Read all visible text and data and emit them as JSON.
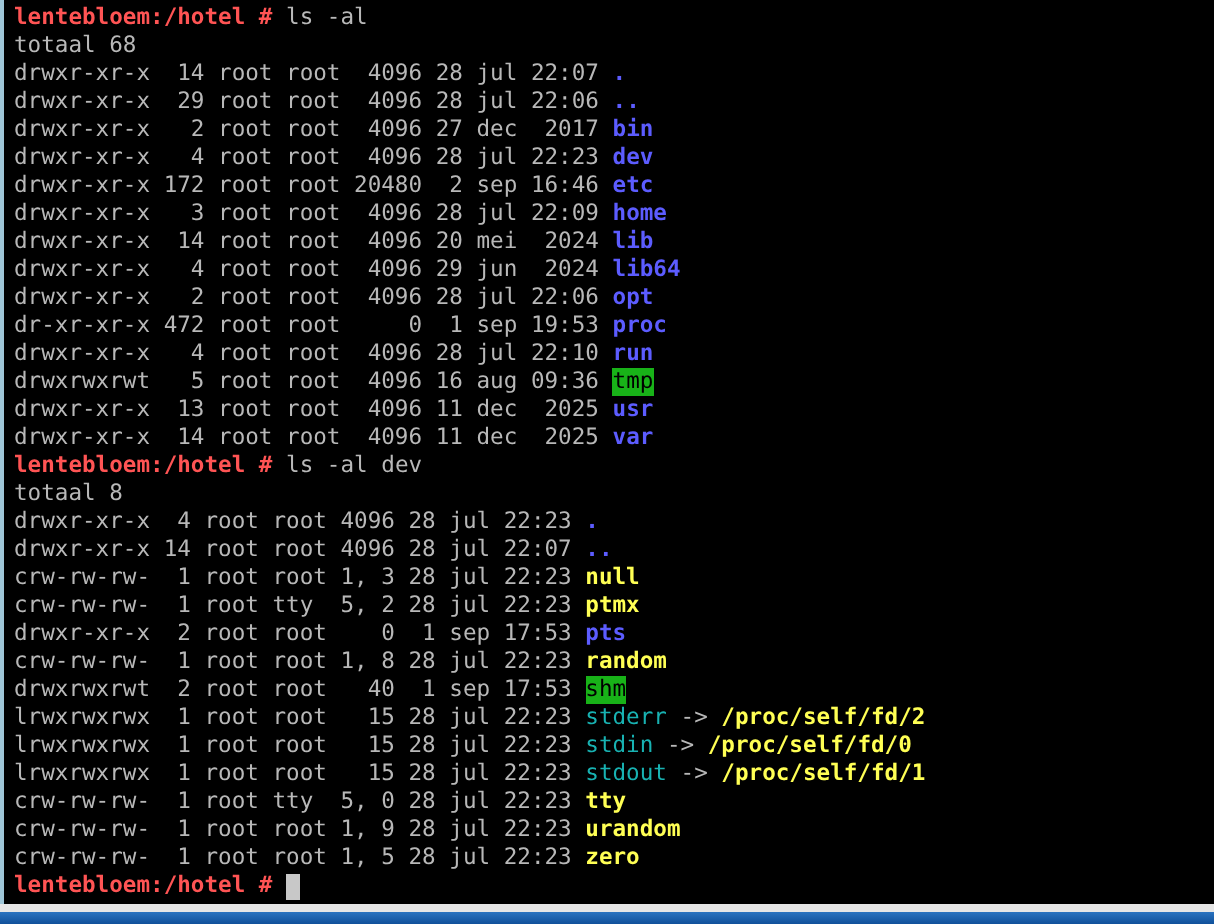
{
  "terminal": {
    "lines": [
      {
        "kind": "prompt",
        "prompt": "lentebloem:/hotel #",
        "command": "ls -al",
        "cursor": false
      },
      {
        "kind": "text",
        "text": "totaal 68"
      },
      {
        "kind": "dir",
        "meta": "drwxr-xr-x  14 root root  4096 28 jul 22:07",
        "name": "."
      },
      {
        "kind": "dir",
        "meta": "drwxr-xr-x  29 root root  4096 28 jul 22:06",
        "name": ".."
      },
      {
        "kind": "dir",
        "meta": "drwxr-xr-x   2 root root  4096 27 dec  2017",
        "name": "bin"
      },
      {
        "kind": "dir",
        "meta": "drwxr-xr-x   4 root root  4096 28 jul 22:23",
        "name": "dev"
      },
      {
        "kind": "dir",
        "meta": "drwxr-xr-x 172 root root 20480  2 sep 16:46",
        "name": "etc"
      },
      {
        "kind": "dir",
        "meta": "drwxr-xr-x   3 root root  4096 28 jul 22:09",
        "name": "home"
      },
      {
        "kind": "dir",
        "meta": "drwxr-xr-x  14 root root  4096 20 mei  2024",
        "name": "lib"
      },
      {
        "kind": "dir",
        "meta": "drwxr-xr-x   4 root root  4096 29 jun  2024",
        "name": "lib64"
      },
      {
        "kind": "dir",
        "meta": "drwxr-xr-x   2 root root  4096 28 jul 22:06",
        "name": "opt"
      },
      {
        "kind": "dir",
        "meta": "dr-xr-xr-x 472 root root     0  1 sep 19:53",
        "name": "proc"
      },
      {
        "kind": "dir",
        "meta": "drwxr-xr-x   4 root root  4096 28 jul 22:10",
        "name": "run"
      },
      {
        "kind": "sticky",
        "meta": "drwxrwxrwt   5 root root  4096 16 aug 09:36",
        "name": "tmp"
      },
      {
        "kind": "dir",
        "meta": "drwxr-xr-x  13 root root  4096 11 dec  2025",
        "name": "usr"
      },
      {
        "kind": "dir",
        "meta": "drwxr-xr-x  14 root root  4096 11 dec  2025",
        "name": "var"
      },
      {
        "kind": "prompt",
        "prompt": "lentebloem:/hotel #",
        "command": "ls -al dev",
        "cursor": false
      },
      {
        "kind": "text",
        "text": "totaal 8"
      },
      {
        "kind": "dir",
        "meta": "drwxr-xr-x  4 root root 4096 28 jul 22:23",
        "name": "."
      },
      {
        "kind": "dir",
        "meta": "drwxr-xr-x 14 root root 4096 28 jul 22:07",
        "name": ".."
      },
      {
        "kind": "chardev",
        "meta": "crw-rw-rw-  1 root root 1, 3 28 jul 22:23",
        "name": "null"
      },
      {
        "kind": "chardev",
        "meta": "crw-rw-rw-  1 root tty  5, 2 28 jul 22:23",
        "name": "ptmx"
      },
      {
        "kind": "dir",
        "meta": "drwxr-xr-x  2 root root    0  1 sep 17:53",
        "name": "pts"
      },
      {
        "kind": "chardev",
        "meta": "crw-rw-rw-  1 root root 1, 8 28 jul 22:23",
        "name": "random"
      },
      {
        "kind": "sticky",
        "meta": "drwxrwxrwt  2 root root   40  1 sep 17:53",
        "name": "shm"
      },
      {
        "kind": "symlink",
        "meta": "lrwxrwxrwx  1 root root   15 28 jul 22:23",
        "name": "stderr",
        "arrow": "->",
        "target": "/proc/self/fd/2"
      },
      {
        "kind": "symlink",
        "meta": "lrwxrwxrwx  1 root root   15 28 jul 22:23",
        "name": "stdin",
        "arrow": "->",
        "target": "/proc/self/fd/0"
      },
      {
        "kind": "symlink",
        "meta": "lrwxrwxrwx  1 root root   15 28 jul 22:23",
        "name": "stdout",
        "arrow": "->",
        "target": "/proc/self/fd/1"
      },
      {
        "kind": "chardev",
        "meta": "crw-rw-rw-  1 root tty  5, 0 28 jul 22:23",
        "name": "tty"
      },
      {
        "kind": "chardev",
        "meta": "crw-rw-rw-  1 root root 1, 9 28 jul 22:23",
        "name": "urandom"
      },
      {
        "kind": "chardev",
        "meta": "crw-rw-rw-  1 root root 1, 5 28 jul 22:23",
        "name": "zero"
      },
      {
        "kind": "prompt",
        "prompt": "lentebloem:/hotel #",
        "cursor": true
      }
    ]
  }
}
